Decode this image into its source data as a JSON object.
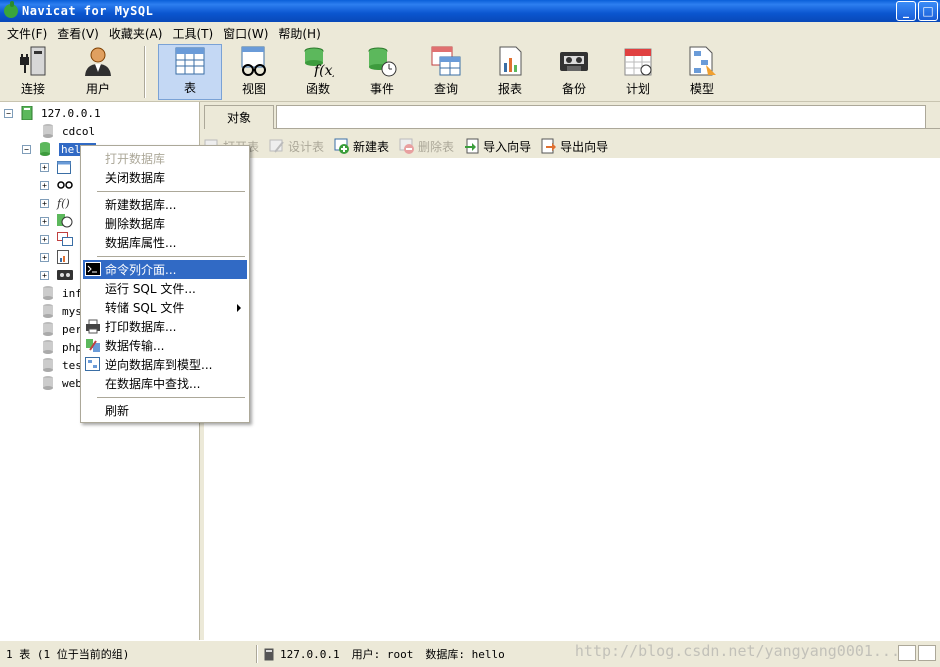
{
  "window": {
    "title": "Navicat for MySQL"
  },
  "menu": [
    "文件(F)",
    "查看(V)",
    "收藏夹(A)",
    "工具(T)",
    "窗口(W)",
    "帮助(H)"
  ],
  "toolbar": {
    "connect": "连接",
    "user": "用户",
    "table": "表",
    "view": "视图",
    "function": "函数",
    "event": "事件",
    "query": "查询",
    "report": "报表",
    "backup": "备份",
    "schedule": "计划",
    "model": "模型"
  },
  "tree": {
    "connection": "127.0.0.1",
    "databases": [
      "cdcol",
      "hello",
      "inf",
      "mys",
      "per",
      "php",
      "tes",
      "web"
    ]
  },
  "tab": {
    "label": "对象"
  },
  "object_toolbar": {
    "open_table": "打开表",
    "design_table": "设计表",
    "new_table": "新建表",
    "delete_table": "删除表",
    "import_wizard": "导入向导",
    "export_wizard": "导出向导"
  },
  "context_menu": {
    "open_db": "打开数据库",
    "close_db": "关闭数据库",
    "new_db": "新建数据库...",
    "delete_db": "删除数据库",
    "db_properties": "数据库属性...",
    "console": "命令列介面...",
    "run_sql": "运行 SQL 文件...",
    "dump_sql": "转储 SQL 文件",
    "print_db": "打印数据库...",
    "data_transfer": "数据传输...",
    "reverse_model": "逆向数据库到模型...",
    "find_in_db": "在数据库中查找...",
    "refresh": "刷新"
  },
  "status": {
    "count": "1 表 (1 位于当前的组)",
    "host": "127.0.0.1",
    "user": "用户: root",
    "database": "数据库: hello"
  },
  "watermark": "http://blog.csdn.net/yangyang0001..."
}
